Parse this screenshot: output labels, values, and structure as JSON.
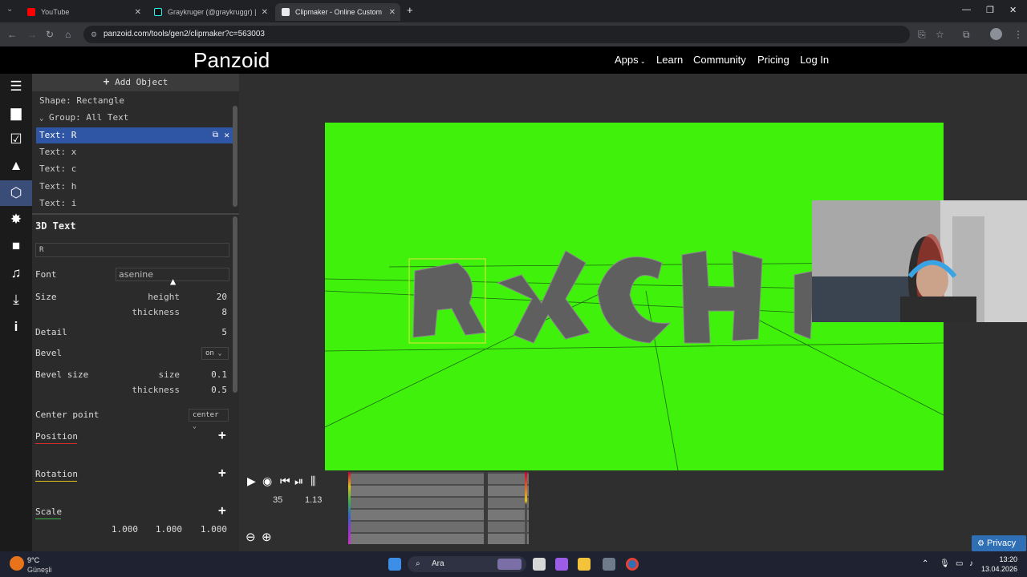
{
  "browser": {
    "tabs": [
      {
        "label": "YouTube",
        "active": false
      },
      {
        "label": "Graykruger (@graykruggr) | Tik",
        "active": false
      },
      {
        "label": "Clipmaker - Online Custom Intr",
        "active": true
      }
    ],
    "url": "panzoid.com/tools/gen2/clipmaker?c=563003"
  },
  "site": {
    "logo": "Panzoid",
    "nav": [
      "Apps",
      "Learn",
      "Community",
      "Pricing",
      "Log In"
    ]
  },
  "rail_icons": [
    "menu-icon",
    "folder-icon",
    "checkbox-icon",
    "image-icon",
    "3d-cube-icon",
    "burst-icon",
    "camera-icon",
    "music-icon",
    "download-icon",
    "info-icon"
  ],
  "panel": {
    "add_object": "Add Object",
    "objects": [
      {
        "label": "Shape: Rectangle"
      },
      {
        "label": "Group: All Text"
      },
      {
        "label": "Text: R"
      },
      {
        "label": "Text: x"
      },
      {
        "label": "Text: c"
      },
      {
        "label": "Text: h"
      },
      {
        "label": "Text: i"
      }
    ],
    "section_title": "3D Text",
    "text_value": "R",
    "font_label": "Font",
    "font_value": "asenine",
    "size_label": "Size",
    "height_label": "height",
    "height_value": "20",
    "thickness_label": "thickness",
    "thickness_value": "8",
    "detail_label": "Detail",
    "detail_value": "5",
    "bevel_label": "Bevel",
    "bevel_value": "on",
    "bevel_size_label": "Bevel size",
    "bevel_size_sub": "size",
    "bevel_size_value": "0.1",
    "bevel_thickness_label": "thickness",
    "bevel_thickness_value": "0.5",
    "center_label": "Center point",
    "center_value": "center",
    "position_label": "Position",
    "rotation_label": "Rotation",
    "scale_label": "Scale",
    "scale_values": [
      "1.000",
      "1.000",
      "1.000"
    ]
  },
  "timeline": {
    "frame": "35",
    "time": "1.13"
  },
  "privacy_label": "Privacy",
  "taskbar": {
    "weather_temp": "9°C",
    "weather_desc": "Güneşli",
    "search_placeholder": "Ara",
    "time": "13:20",
    "date": "13.04.2026"
  },
  "colors": {
    "green_screen": "#3ff10b",
    "selected_row": "#2f55a5",
    "position_accent": "#d0302a",
    "rotation_accent": "#e3c21c",
    "scale_accent": "#3cb34a"
  }
}
